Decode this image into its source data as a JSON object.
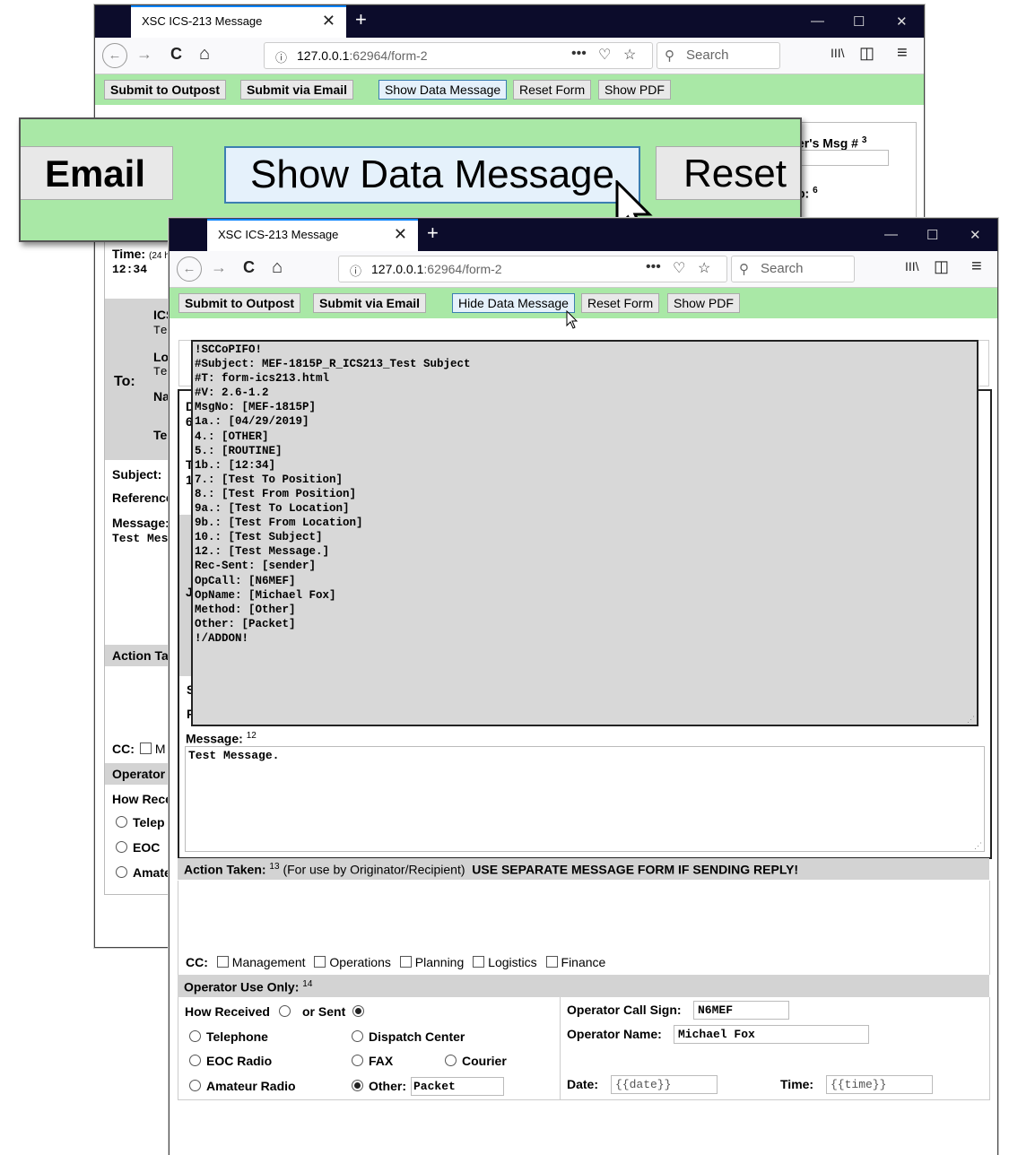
{
  "browser": {
    "tab_title": "XSC ICS-213 Message",
    "tab_close": "✕",
    "new_tab": "+",
    "minimize": "—",
    "maximize": "☐",
    "close": "✕",
    "url_host": "127.0.0.1",
    "url_rest": ":62964/form-2",
    "url_dots": "•••",
    "search_placeholder": "Search",
    "back_glyph": "←",
    "forward_glyph": "→",
    "reload_glyph": "C",
    "home_glyph": "⌂",
    "library_glyph": "III\\",
    "sidebar_glyph": "◫",
    "menu_glyph": "≡"
  },
  "toolbar_back": {
    "submit_outpost": "Submit to Outpost",
    "submit_email": "Submit via Email",
    "show_data": "Show Data Message",
    "reset": "Reset Form",
    "show_pdf": "Show PDF"
  },
  "toolbar_front": {
    "submit_outpost": "Submit to Outpost",
    "submit_email": "Submit via Email",
    "hide_data": "Hide Data Message",
    "reset": "Reset Form",
    "show_pdf": "Show PDF"
  },
  "zoom": {
    "email": "Email",
    "show_data": "Show Data Message",
    "reset": "Reset"
  },
  "back_form": {
    "senders_msg": "er's Msg #",
    "senders_sup": "3",
    "p6": "p:",
    "p6_sup": "6",
    "time_label": "Time:",
    "time_hint": "(24 h",
    "time_value": "12:34",
    "ics": "ICS",
    "te1": "Te",
    "lo": "Lo",
    "te2": "Te",
    "na": "Na",
    "tel": "Tel",
    "to": "To:",
    "subject": "Subject:",
    "reference": "Reference",
    "message": "Message:",
    "test_mes": "Test Mes",
    "action_taken": "Action Tak",
    "cc": "CC:",
    "cc_m": "M",
    "operator": "Operator",
    "how_rece": "How Rece",
    "teleph": "Telep",
    "eoc": "EOC",
    "amate": "Amate"
  },
  "data_message": [
    "!SCCoPIFO!",
    "#Subject: MEF-1815P_R_ICS213_Test Subject",
    "#T: form-ics213.html",
    "#V: 2.6-1.2",
    "MsgNo: [MEF-1815P]",
    "1a.: [04/29/2019]",
    "4.: [OTHER]",
    "5.: [ROUTINE]",
    "1b.: [12:34]",
    "7.: [Test To Position]",
    "8.: [Test From Position]",
    "9a.: [Test To Location]",
    "9b.: [Test From Location]",
    "10.: [Test Subject]",
    "12.: [Test Message.]",
    "Rec-Sent: [sender]",
    "OpCall: [N6MEF]",
    "OpName: [Michael Fox]",
    "Method: [Other]",
    "Other: [Packet]",
    "!/ADDON!"
  ],
  "front_form": {
    "message_label": "Message:",
    "message_sup": "12",
    "message_value": "Test Message.",
    "action_label": "Action Taken:",
    "action_sup": "13",
    "action_note": "(For use by Originator/Recipient)",
    "action_warning": "USE SEPARATE MESSAGE FORM IF SENDING REPLY!",
    "cc_label": "CC:",
    "cc_options": [
      "Management",
      "Operations",
      "Planning",
      "Logistics",
      "Finance"
    ],
    "operator_label": "Operator Use Only:",
    "operator_sup": "14",
    "how_received": "How Received",
    "or_sent": "or Sent",
    "telephone": "Telephone",
    "dispatch": "Dispatch Center",
    "eoc_radio": "EOC Radio",
    "fax": "FAX",
    "courier": "Courier",
    "amateur": "Amateur Radio",
    "other": "Other:",
    "other_value": "Packet",
    "op_call_label": "Operator Call Sign:",
    "op_call_value": "N6MEF",
    "op_name_label": "Operator Name:",
    "op_name_value": "Michael Fox",
    "date_label": "Date:",
    "date_value": "{{date}}",
    "time_label": "Time:",
    "time_value": "{{time}}",
    "frag_s": "S",
    "frag_r": "R",
    "frag_d": "D",
    "frag_6": "6",
    "frag_t": "T",
    "frag_1": "1",
    "frag_j": "J"
  }
}
